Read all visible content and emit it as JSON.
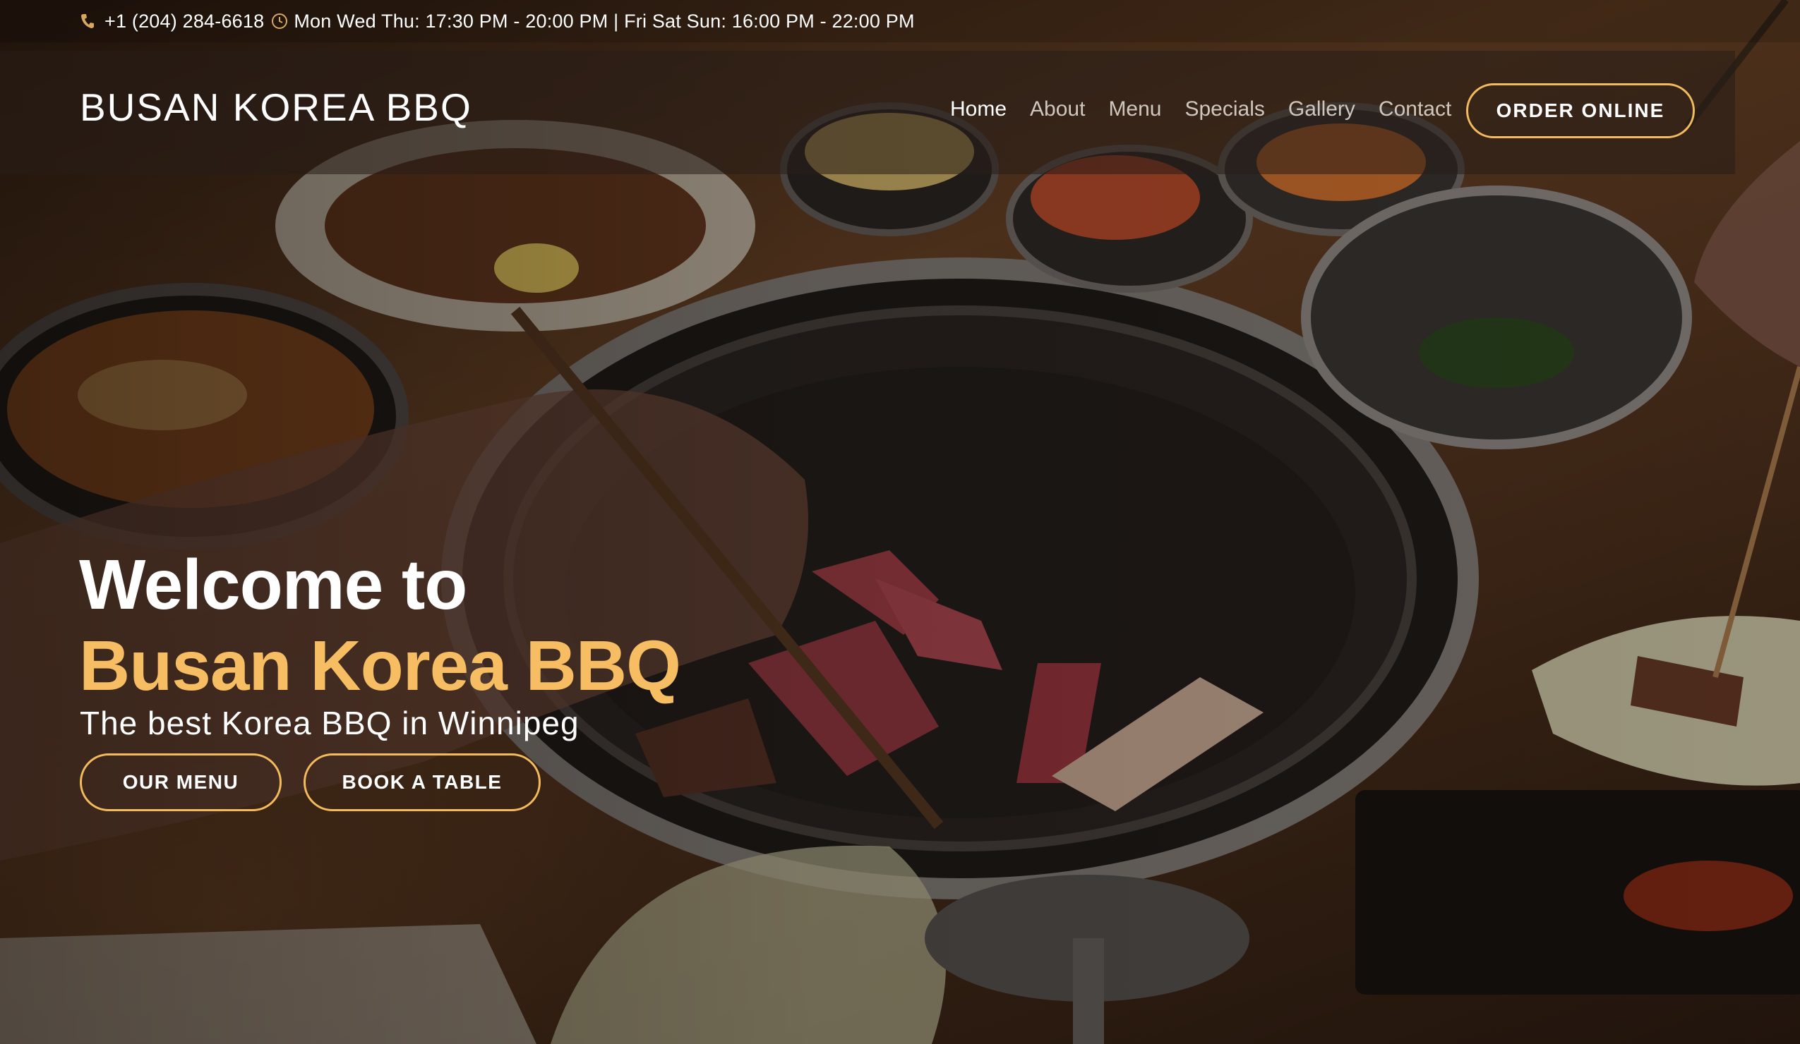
{
  "topbar": {
    "phone_icon": "phone-icon",
    "phone": "+1 (204) 284-6618",
    "clock_icon": "clock-icon",
    "hours": "Mon  Wed  Thu: 17:30 PM - 20:00 PM | Fri  Sat  Sun: 16:00 PM - 22:00 PM"
  },
  "header": {
    "logo": "BUSAN KOREA BBQ",
    "nav": [
      {
        "label": "Home",
        "active": true
      },
      {
        "label": "About",
        "active": false
      },
      {
        "label": "Menu",
        "active": false
      },
      {
        "label": "Specials",
        "active": false
      },
      {
        "label": "Gallery",
        "active": false
      },
      {
        "label": "Contact",
        "active": false
      }
    ],
    "order_label": "ORDER ONLINE"
  },
  "hero": {
    "line1": "Welcome to",
    "line2": "Busan Korea BBQ",
    "subtitle": "The best Korea BBQ in Winnipeg",
    "menu_button": "OUR MENU",
    "book_button": "BOOK A TABLE"
  },
  "colors": {
    "accent": "#f6bd62",
    "button_border": "#f2bb5d",
    "nav_inactive": "#cfc7bd",
    "text": "#ffffff"
  }
}
